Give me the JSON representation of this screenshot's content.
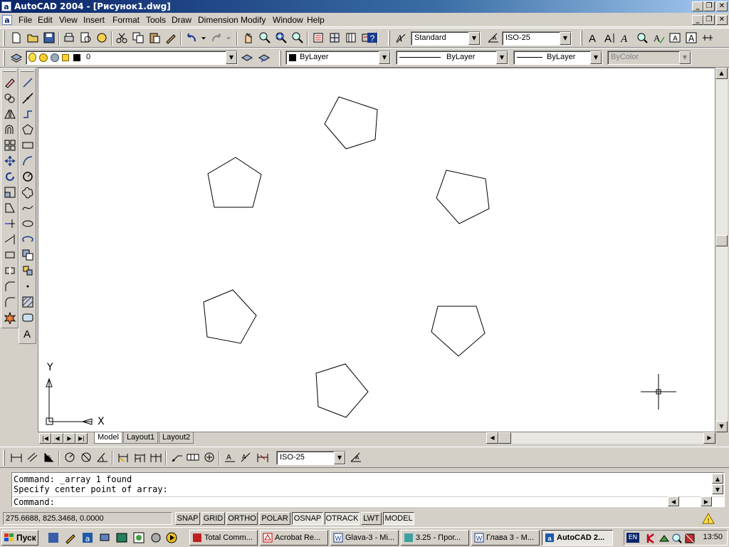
{
  "window": {
    "title": "AutoCAD 2004 - [Рисунок1.dwg]",
    "app_icon_letter": "a"
  },
  "menu": [
    "File",
    "Edit",
    "View",
    "Insert",
    "Format",
    "Tools",
    "Draw",
    "Dimension",
    "Modify",
    "Window",
    "Help"
  ],
  "toolbar_styles": {
    "text_style": "Standard",
    "dim_style": "ISO-25"
  },
  "layers_toolbar": {
    "layer_name": "0",
    "color": "ByLayer",
    "linetype": "ByLayer",
    "lineweight": "ByLayer",
    "plotstyle": "ByColor"
  },
  "dimension_toolbar": {
    "dim_style": "ISO-25"
  },
  "ucs": {
    "x_label": "X",
    "y_label": "Y"
  },
  "layout_tabs": [
    "Model",
    "Layout1",
    "Layout2"
  ],
  "active_tab": "Model",
  "command": {
    "history": [
      "Command: _array 1 found",
      "Specify center point of array:"
    ],
    "prompt": "Command:"
  },
  "status": {
    "coords": "275.6688, 825.3468, 0.0000",
    "toggles": [
      "SNAP",
      "GRID",
      "ORTHO",
      "POLAR",
      "OSNAP",
      "OTRACK",
      "LWT",
      "MODEL"
    ],
    "active": [
      "OSNAP",
      "OTRACK",
      "MODEL"
    ]
  },
  "taskbar": {
    "start_label": "Пуск",
    "tasks": [
      "Total Comm...",
      "Acrobat Re...",
      "Glava-3 - Mi...",
      "3.25 - Прог...",
      "Глава 3 - M...",
      "AutoCAD 2..."
    ],
    "active_task": "AutoCAD 2...",
    "language": "EN",
    "clock": "13:50"
  },
  "colors": {
    "titlebar": "#0a246a",
    "canvas": "#ffffff",
    "chrome": "#d4d0c8"
  }
}
